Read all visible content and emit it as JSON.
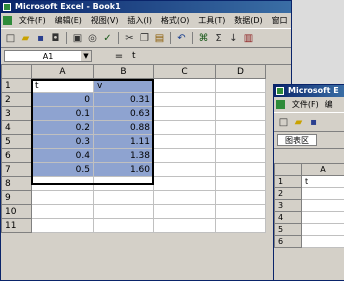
{
  "window1": {
    "title": "Microsoft Excel - Book1",
    "menu": [
      "文件(F)",
      "编辑(E)",
      "视图(V)",
      "插入(I)",
      "格式(O)",
      "工具(T)",
      "数据(D)",
      "窗口"
    ],
    "toolbar_icons": [
      "new-icon",
      "open-icon",
      "save-icon",
      "permission-icon",
      "print-icon",
      "preview-icon",
      "spell-icon",
      "cut-icon",
      "copy-icon",
      "paste-icon",
      "undo-icon",
      "hyperlink-icon",
      "sum-icon",
      "sort-icon",
      "chart-icon"
    ],
    "namebox": "A1",
    "formula_fx": "=",
    "formula_value": "t",
    "columns": [
      "A",
      "B",
      "C",
      "D"
    ],
    "rows": [
      {
        "n": "1",
        "a": "t",
        "b": "v"
      },
      {
        "n": "2",
        "a": "0",
        "b": "0.31"
      },
      {
        "n": "3",
        "a": "0.1",
        "b": "0.63"
      },
      {
        "n": "4",
        "a": "0.2",
        "b": "0.88"
      },
      {
        "n": "5",
        "a": "0.3",
        "b": "1.11"
      },
      {
        "n": "6",
        "a": "0.4",
        "b": "1.38"
      },
      {
        "n": "7",
        "a": "0.5",
        "b": "1.60"
      },
      {
        "n": "8",
        "a": "",
        "b": ""
      },
      {
        "n": "9",
        "a": "",
        "b": ""
      },
      {
        "n": "10",
        "a": "",
        "b": ""
      },
      {
        "n": "11",
        "a": "",
        "b": ""
      }
    ],
    "selection_color": "#8ea3d0"
  },
  "window2": {
    "title": "Microsoft E",
    "menu": [
      "文件(F)",
      "编"
    ],
    "namebox": "图表区",
    "column": "A",
    "rows": [
      {
        "n": "1",
        "a": "t"
      },
      {
        "n": "2",
        "a": ""
      },
      {
        "n": "3",
        "a": ""
      },
      {
        "n": "4",
        "a": ""
      },
      {
        "n": "5",
        "a": ""
      },
      {
        "n": "6",
        "a": ""
      }
    ]
  }
}
